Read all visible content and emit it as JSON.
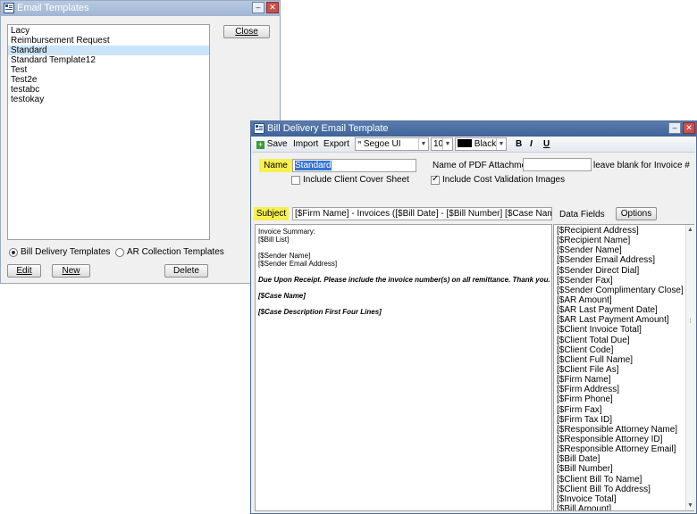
{
  "email_templates": {
    "title": "Email Templates",
    "templates": [
      "Lacy",
      "Reimbursement Request",
      "Standard",
      "Standard Template12",
      "Test",
      "Test2e",
      "testabc",
      "testokay"
    ],
    "selected_index": 2,
    "close_label": "Close",
    "radio_bill": "Bill Delivery Templates",
    "radio_ar": "AR Collection Templates",
    "edit_label": "Edit",
    "new_label": "New",
    "delete_label": "Delete"
  },
  "bill_delivery": {
    "title": "Bill Delivery Email Template",
    "toolbar": {
      "save": "Save",
      "import": "Import",
      "export": "Export",
      "font": "Segoe UI",
      "size": "10",
      "color_name": "Black",
      "color_hex": "#000000",
      "bold": "B",
      "italic": "I",
      "underline": "U"
    },
    "name_label": "Name",
    "name_value": "Standard",
    "pdf_label": "Name of PDF Attachment",
    "pdf_value": "",
    "pdf_hint": "leave blank for Invoice #",
    "include_cover": "Include Client Cover Sheet",
    "include_cost": "Include Cost Validation Images",
    "subject_label": "Subject",
    "subject_value": "[$Firm Name] - Invoices ([$Bill Date] -  [$Bill Number]   [$Case Name] [$Cas",
    "data_fields_label": "Data Fields",
    "options_label": "Options",
    "body": {
      "l1": "Invoice Summary:",
      "l2": "[$Bill List]",
      "l3": "[$Sender Name]",
      "l4": "[$Sender Email Address]",
      "l5": "Due Upon Receipt.  Please include the invoice number(s) on all remittance.  Thank you.",
      "l6": "[$Case Name]",
      "l7": "[$Case Description First Four Lines]"
    },
    "fields": [
      "[$Recipient Address]",
      "[$Recipient Name]",
      "[$Sender Name]",
      "[$Sender Email Address]",
      "[$Sender Direct Dial]",
      "[$Sender Fax]",
      "[$Sender Complimentary Close]",
      "[$AR Amount]",
      "[$AR Last Payment Date]",
      "[$AR Last Payment Amount]",
      "[$Client Invoice Total]",
      "[$Client Total Due]",
      "[$Client Code]",
      "[$Client Full Name]",
      "[$Client File As]",
      "[$Firm Name]",
      "[$Firm Address]",
      "[$Firm Phone]",
      "[$Firm Fax]",
      "[$Firm Tax ID]",
      "[$Responsible Attorney Name]",
      "[$Responsible Attorney ID]",
      "[$Responsible Attorney Email]",
      "[$Bill Date]",
      "[$Bill Number]",
      "[$Client Bill To Name]",
      "[$Client Bill To Address]",
      "[$Invoice Total]",
      "[$Bill Amount]"
    ]
  }
}
